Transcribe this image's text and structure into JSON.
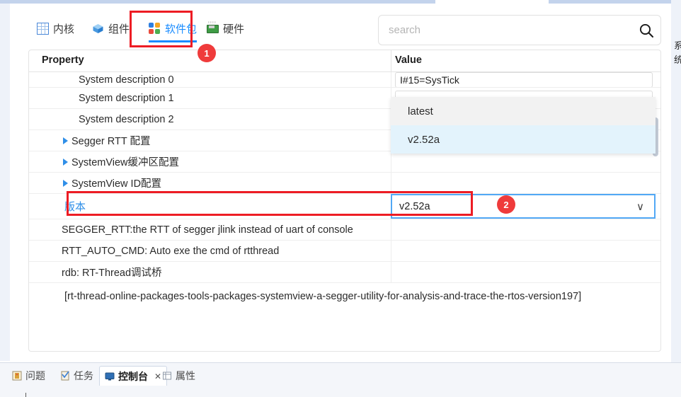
{
  "window": {
    "rail_expand_label": "»"
  },
  "tabs": [
    {
      "id": "kernel",
      "label": "内核",
      "icon": "grid-icon",
      "active": false
    },
    {
      "id": "component",
      "label": "组件",
      "icon": "cube-icon",
      "active": false
    },
    {
      "id": "package",
      "label": "软件包",
      "icon": "packages-icon",
      "active": true
    },
    {
      "id": "hardware",
      "label": "硬件",
      "icon": "chip-icon",
      "active": false
    }
  ],
  "search": {
    "value": "",
    "placeholder": "search",
    "icon": "search-icon"
  },
  "table": {
    "headers": {
      "property": "Property",
      "value": "Value"
    },
    "rows": [
      {
        "label": "System description 0",
        "value": "I#15=SysTick",
        "kind": "input",
        "clipped": true
      },
      {
        "label": "System description 1",
        "value": "",
        "kind": "input"
      },
      {
        "label": "System description 2",
        "value": "",
        "kind": "input"
      },
      {
        "label": "Segger RTT 配置",
        "value": "",
        "kind": "expander"
      },
      {
        "label": "SystemView缓冲区配置",
        "value": "",
        "kind": "expander"
      },
      {
        "label": "SystemView ID配置",
        "value": "",
        "kind": "expander"
      }
    ],
    "version_row": {
      "label": "版本",
      "value": "v2.52a",
      "arrow_icon": "chevron-down-icon",
      "options": [
        {
          "label": "latest",
          "selected": false
        },
        {
          "label": "v2.52a",
          "selected": true
        }
      ]
    },
    "description_rows": [
      "SEGGER_RTT:the RTT of segger jlink instead of uart of console",
      "RTT_AUTO_CMD: Auto exe the cmd of rtthread",
      "rdb: RT-Thread调试桥"
    ],
    "footnote": "[rt-thread-online-packages-tools-packages-systemview-a-segger-utility-for-analysis-and-trace-the-rtos-version197]"
  },
  "annotations": [
    {
      "id": "1",
      "label": "1"
    },
    {
      "id": "2",
      "label": "2"
    }
  ],
  "bottom_tabs": [
    {
      "id": "problems",
      "label": "问题",
      "icon": "problems-icon",
      "active": false,
      "closable": false
    },
    {
      "id": "tasks",
      "label": "任务",
      "icon": "tasks-icon",
      "active": false,
      "closable": false
    },
    {
      "id": "console",
      "label": "控制台",
      "icon": "console-icon",
      "active": true,
      "closable": true,
      "close_label": "✕"
    },
    {
      "id": "props",
      "label": "属性",
      "icon": "properties-icon",
      "active": false,
      "closable": false
    }
  ],
  "colors": {
    "accent_blue": "#1a8cff",
    "highlight_red": "#ed1c24",
    "badge_red": "#ef3b3b",
    "selected_option": "#e3f3fc",
    "dropdown_bg": "#f2f2f2",
    "rail": "#eef2f9"
  }
}
